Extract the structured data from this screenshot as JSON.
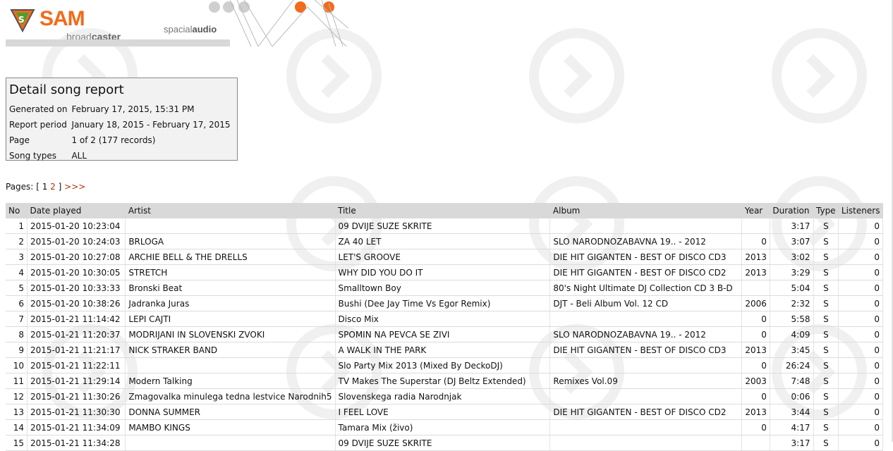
{
  "header": {
    "logo_sam": "SAM",
    "logo_broad": "broad",
    "logo_caster": "caster",
    "spacial_a": "spacial",
    "spacial_b": "audio"
  },
  "report": {
    "title": "Detail song report",
    "rows": [
      {
        "label": "Generated on",
        "value": "February 17, 2015, 15:31 PM"
      },
      {
        "label": "Report period",
        "value": "January 18, 2015 - February 17, 2015"
      },
      {
        "label": "Page",
        "value": "1 of 2 (177 records)"
      },
      {
        "label": "Song types",
        "value": "ALL"
      }
    ]
  },
  "pagination": {
    "label": "Pages:",
    "open": "[",
    "current": "1",
    "next_page": "2",
    "close": "]",
    "more": ">>>"
  },
  "table": {
    "headers": [
      "No",
      "Date played",
      "Artist",
      "Title",
      "Album",
      "Year",
      "Duration",
      "Type",
      "Listeners"
    ],
    "rows": [
      [
        "1",
        "2015-01-20 10:23:04",
        "",
        "09 DVIJE SUZE SKRITE",
        "",
        "",
        "3:17",
        "S",
        "0"
      ],
      [
        "2",
        "2015-01-20 10:24:03",
        "BRLOGA",
        "ZA 40 LET",
        "SLO NARODNOZABAVNA 19.. - 2012",
        "0",
        "3:07",
        "S",
        "0"
      ],
      [
        "3",
        "2015-01-20 10:27:08",
        "ARCHIE BELL & THE DRELLS",
        "LET'S GROOVE",
        "DIE HIT GIGANTEN - BEST OF DISCO CD3",
        "2013",
        "3:02",
        "S",
        "0"
      ],
      [
        "4",
        "2015-01-20 10:30:05",
        "STRETCH",
        "WHY DID YOU DO IT",
        "DIE HIT GIGANTEN - BEST OF DISCO CD2",
        "2013",
        "3:29",
        "S",
        "0"
      ],
      [
        "5",
        "2015-01-20 10:33:33",
        "Bronski Beat",
        "Smalltown Boy",
        "80's Night Ultimate DJ Collection CD 3 B-D",
        "",
        "5:04",
        "S",
        "0"
      ],
      [
        "6",
        "2015-01-20 10:38:26",
        "Jadranka Juras",
        "Bushi (Dee Jay Time Vs Egor Remix)",
        "DJT - Beli Album Vol. 12 CD",
        "2006",
        "2:32",
        "S",
        "0"
      ],
      [
        "7",
        "2015-01-21 11:14:42",
        "LEPI CAJTI",
        "Disco Mix",
        "",
        "0",
        "5:58",
        "S",
        "0"
      ],
      [
        "8",
        "2015-01-21 11:20:37",
        "MODRIJANI IN SLOVENSKI ZVOKI",
        "SPOMIN NA PEVCA SE ZIVI",
        "SLO NARODNOZABAVNA 19.. - 2012",
        "0",
        "4:09",
        "S",
        "0"
      ],
      [
        "9",
        "2015-01-21 11:21:17",
        "NICK STRAKER BAND",
        "A WALK IN THE PARK",
        "DIE HIT GIGANTEN - BEST OF DISCO CD3",
        "2013",
        "3:45",
        "S",
        "0"
      ],
      [
        "10",
        "2015-01-21 11:22:11",
        "",
        "Slo Party Mix 2013 (Mixed By DeckoDJ)",
        "",
        "0",
        "26:24",
        "S",
        "0"
      ],
      [
        "11",
        "2015-01-21 11:29:14",
        "Modern Talking",
        "TV Makes The Superstar (DJ Beltz Extended)",
        "Remixes Vol.09",
        "2003",
        "7:48",
        "S",
        "0"
      ],
      [
        "12",
        "2015-01-21 11:30:26",
        "Zmagovalka minulega tedna lestvice Narodnih5",
        "Slovenskega radia Narodnjak",
        "",
        "0",
        "0:06",
        "S",
        "0"
      ],
      [
        "13",
        "2015-01-21 11:30:30",
        "DONNA SUMMER",
        "I FEEL LOVE",
        "DIE HIT GIGANTEN - BEST OF DISCO CD2",
        "2013",
        "3:44",
        "S",
        "0"
      ],
      [
        "14",
        "2015-01-21 11:34:09",
        "MAMBO KINGS",
        "Tamara Mix (živo)",
        "",
        "0",
        "4:17",
        "S",
        "0"
      ],
      [
        "15",
        "2015-01-21 11:34:28",
        "",
        "09 DVIJE SUZE SKRITE",
        "",
        "",
        "3:17",
        "S",
        "0"
      ]
    ]
  },
  "colors": {
    "brand_orange": "#f26a1b",
    "header_row": "#d9d9d9",
    "link": "#b03000"
  }
}
